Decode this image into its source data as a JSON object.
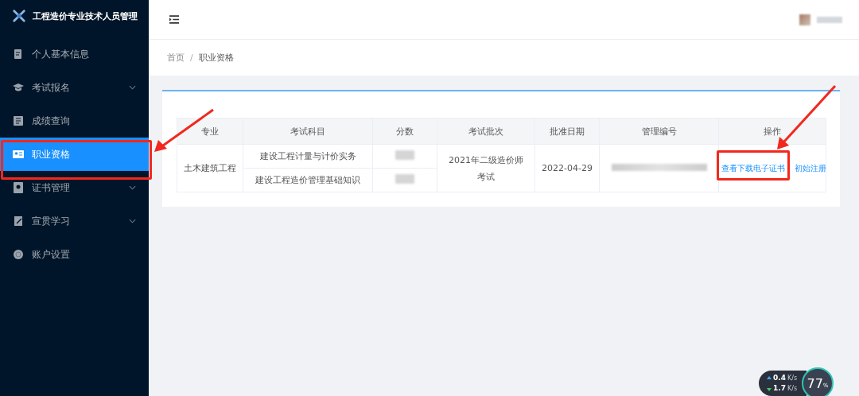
{
  "sidebar": {
    "title": "工程造价专业技术人员管理",
    "items": [
      {
        "label": "个人基本信息",
        "expandable": false,
        "selected": false
      },
      {
        "label": "考试报名",
        "expandable": true,
        "selected": false
      },
      {
        "label": "成绩查询",
        "expandable": false,
        "selected": false
      },
      {
        "label": "职业资格",
        "expandable": false,
        "selected": true
      },
      {
        "label": "证书管理",
        "expandable": true,
        "selected": false
      },
      {
        "label": "宣贯学习",
        "expandable": true,
        "selected": false
      },
      {
        "label": "账户设置",
        "expandable": false,
        "selected": false
      }
    ]
  },
  "breadcrumb": {
    "items": [
      "首页",
      "职业资格"
    ],
    "separator": "/"
  },
  "table": {
    "columns": [
      "专业",
      "考试科目",
      "分数",
      "考试批次",
      "批准日期",
      "管理编号",
      "操作"
    ],
    "rows": [
      {
        "major": "土木建筑工程",
        "subjects": [
          "建设工程计量与计价实务",
          "建设工程造价管理基础知识"
        ],
        "batch": "2021年二级造价师考试",
        "approval_date": "2022-04-29",
        "actions": [
          "查看下载电子证书",
          "初始注册"
        ]
      }
    ]
  },
  "net_monitor": {
    "upload": "0.4",
    "upload_unit": "K/s",
    "download": "1.7",
    "download_unit": "K/s",
    "percent": "77",
    "percent_unit": "%"
  }
}
